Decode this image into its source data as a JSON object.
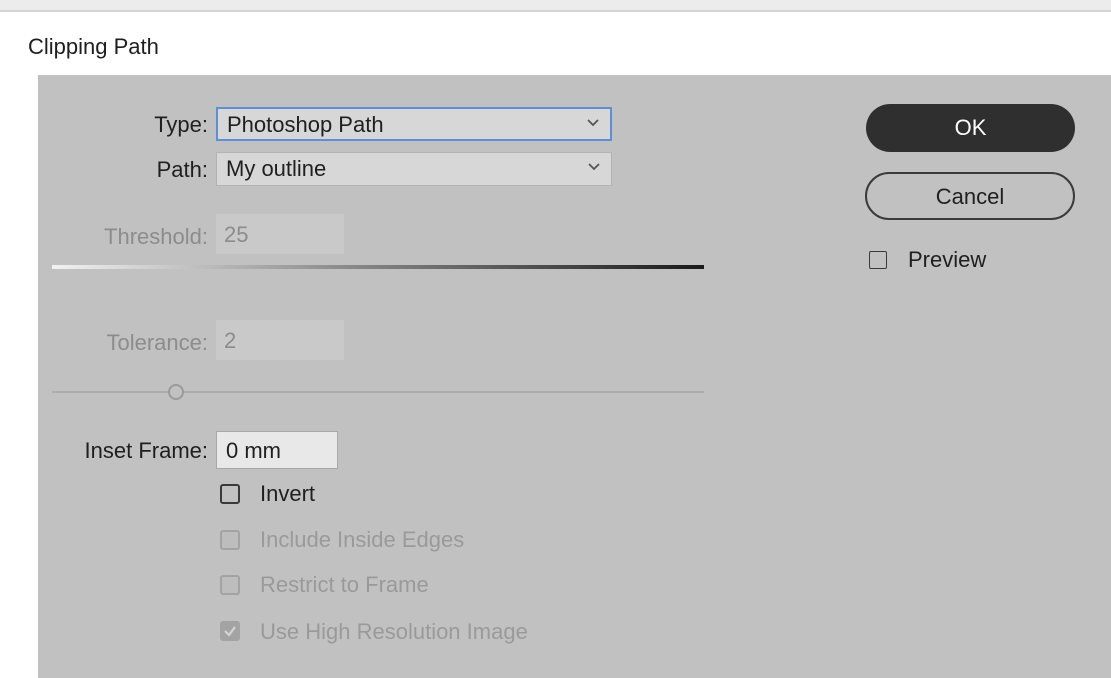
{
  "dialog": {
    "title": "Clipping Path"
  },
  "type": {
    "label": "Type:",
    "value": "Photoshop Path"
  },
  "path": {
    "label": "Path:",
    "value": "My outline"
  },
  "threshold": {
    "label": "Threshold:",
    "value": "25"
  },
  "tolerance": {
    "label": "Tolerance:",
    "value": "2",
    "level": 0.19
  },
  "inset_frame": {
    "label": "Inset Frame:",
    "value": "0 mm"
  },
  "options": {
    "invert": {
      "label": "Invert",
      "checked": false,
      "enabled": true
    },
    "include_inside_edges": {
      "label": "Include Inside Edges",
      "checked": false,
      "enabled": false
    },
    "restrict_to_frame": {
      "label": "Restrict to Frame",
      "checked": false,
      "enabled": false
    },
    "use_high_resolution_image": {
      "label": "Use High Resolution Image",
      "checked": true,
      "enabled": false
    }
  },
  "buttons": {
    "ok": "OK",
    "cancel": "Cancel"
  },
  "preview": {
    "label": "Preview",
    "checked": false
  },
  "colors": {
    "panel": "#c1c1c1",
    "primary_button": "#2f2f2f",
    "focus_ring": "#5b8fd6",
    "disabled_text": "#9a9a9a"
  }
}
